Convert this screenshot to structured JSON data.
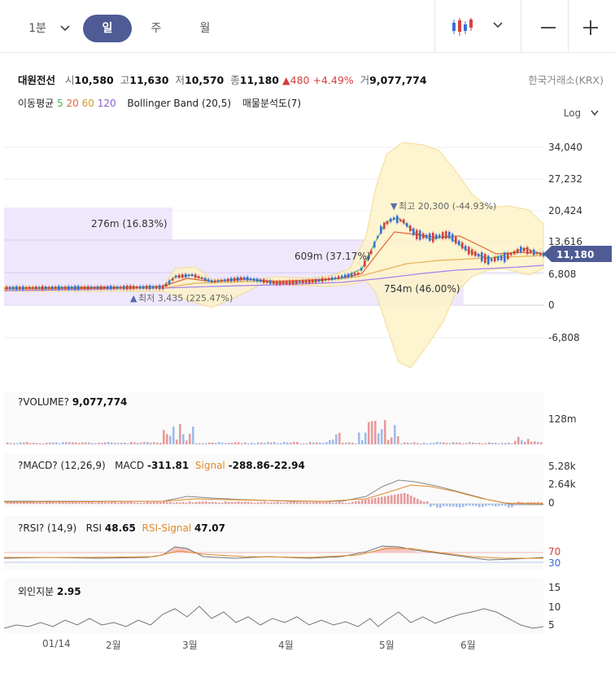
{
  "periods": {
    "minute": "1분",
    "day": "일",
    "week": "주",
    "month": "월"
  },
  "stock": {
    "name": "대원전선",
    "open_label": "시",
    "open": "10,580",
    "high_label": "고",
    "high": "11,630",
    "low_label": "저",
    "low": "10,570",
    "close_label": "종",
    "close": "11,180",
    "change": "480",
    "change_pct": "+4.49%",
    "volume_label": "거",
    "volume": "9,077,774",
    "exchange": "한국거래소(KRX)"
  },
  "indicators": {
    "ma_label": "이동평균",
    "ma5": "5",
    "ma20": "20",
    "ma60": "60",
    "ma120": "120",
    "bollinger": "Bollinger Band (20,5)",
    "volume_profile": "매물분석도(7)"
  },
  "log_label": "Log",
  "price_axis": [
    "34,040",
    "27,232",
    "20,424",
    "13,616",
    "6,808",
    "0",
    "-6,808"
  ],
  "current_price": "11,180",
  "annotations": {
    "vp1": "276m (16.83%)",
    "vp2": "609m (37.17%)",
    "vp3": "754m (46.00%)",
    "high": "최고 20,300 (-44.93%)",
    "low": "최저 3,435 (225.47%)"
  },
  "volume_panel": {
    "title": "?VOLUME?",
    "value": "9,077,774",
    "axis": "128m"
  },
  "macd_panel": {
    "title": "?MACD? (12,26,9)",
    "macd_label": "MACD",
    "macd_value": "-311.81",
    "signal_label": "Signal",
    "signal_value": "-288.86-22.94",
    "axis": [
      "5.28k",
      "2.64k",
      "0"
    ]
  },
  "rsi_panel": {
    "title": "?RSI? (14,9)",
    "rsi_label": "RSI",
    "rsi_value": "48.65",
    "signal_label": "RSI-Signal",
    "signal_value": "47.07",
    "axis": [
      "70",
      "30"
    ]
  },
  "foreign_panel": {
    "title": "외인지분",
    "value": "2.95",
    "axis": [
      "15",
      "10",
      "5"
    ]
  },
  "x_axis": [
    "01/14",
    "2월",
    "3월",
    "4월",
    "5월",
    "6월"
  ],
  "colors": {
    "up": "#d63f3f",
    "down": "#3b6fd9",
    "ma5": "#4caf50",
    "ma20": "#e0663a",
    "ma60": "#d09a2a",
    "ma120": "#8a5bd6",
    "accent": "#4e5b95"
  }
}
